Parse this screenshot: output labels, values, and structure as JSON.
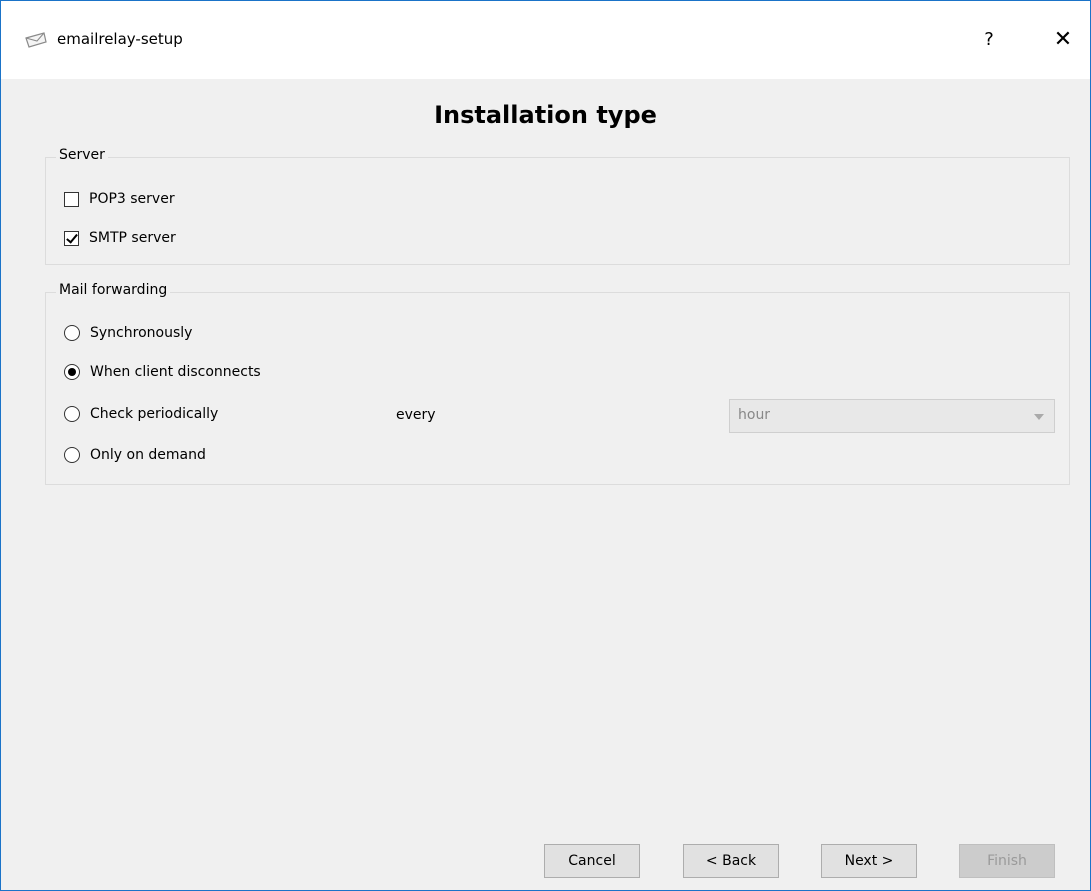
{
  "window": {
    "title": "emailrelay-setup",
    "help_label": "?",
    "close_label": "✕"
  },
  "page": {
    "title": "Installation type"
  },
  "server": {
    "label": "Server",
    "options": [
      {
        "label": "POP3 server",
        "checked": false
      },
      {
        "label": "SMTP server",
        "checked": true
      }
    ]
  },
  "forwarding": {
    "label": "Mail forwarding",
    "options": [
      {
        "label": "Synchronously",
        "selected": false
      },
      {
        "label": "When client disconnects",
        "selected": true
      },
      {
        "label": "Check periodically",
        "selected": false
      },
      {
        "label": "Only on demand",
        "selected": false
      }
    ],
    "every_label": "every",
    "interval": {
      "value": "hour",
      "enabled": false
    }
  },
  "buttons": {
    "cancel": "Cancel",
    "back": "< Back",
    "next": "Next >",
    "finish": "Finish"
  }
}
